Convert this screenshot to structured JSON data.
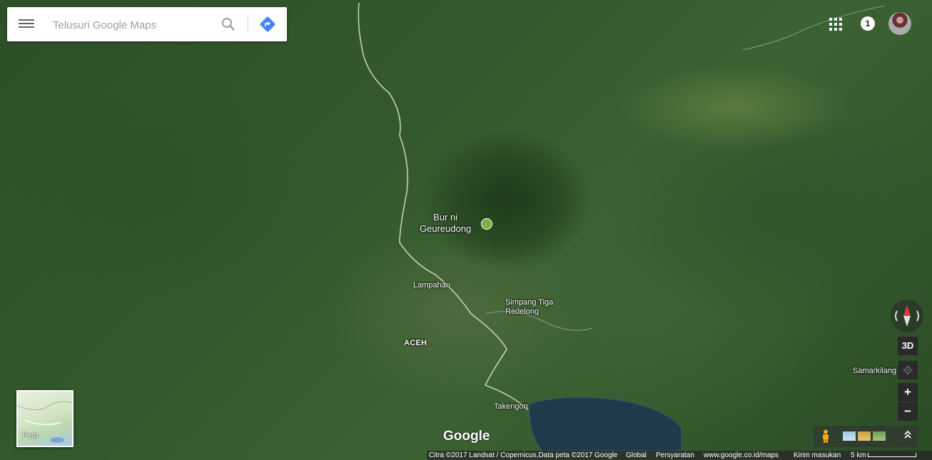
{
  "search": {
    "placeholder": "Telusuri Google Maps"
  },
  "header": {
    "notification_count": "1"
  },
  "map_labels": {
    "peak_line1": "Bur ni",
    "peak_line2": "Geureudong",
    "lampahan": "Lampahan",
    "simpang_line1": "Simpang Tiga",
    "simpang_line2": "Redelong",
    "aceh": "ACEH",
    "takengon": "Takengon",
    "samarkilang": "Samarkilang"
  },
  "controls": {
    "three_d": "3D",
    "zoom_in": "+",
    "zoom_out": "−"
  },
  "minimap": {
    "label": "Peta"
  },
  "logo": "Google",
  "footer": {
    "attribution": "Citra ©2017 Landsat / Copernicus,Data peta ©2017 Google",
    "global": "Global",
    "terms": "Persyaratan",
    "url": "www.google.co.id/maps",
    "feedback": "Kirim masukan",
    "scale": "5 km"
  },
  "colors": {
    "accent": "#4285f4",
    "peak_icon": "#7cb342",
    "compass_red": "#e53935"
  },
  "icons": [
    "menu-icon",
    "search-icon",
    "directions-icon",
    "apps-grid-icon",
    "peak-icon",
    "compass-icon",
    "location-icon",
    "pegman-icon",
    "expand-icon"
  ]
}
